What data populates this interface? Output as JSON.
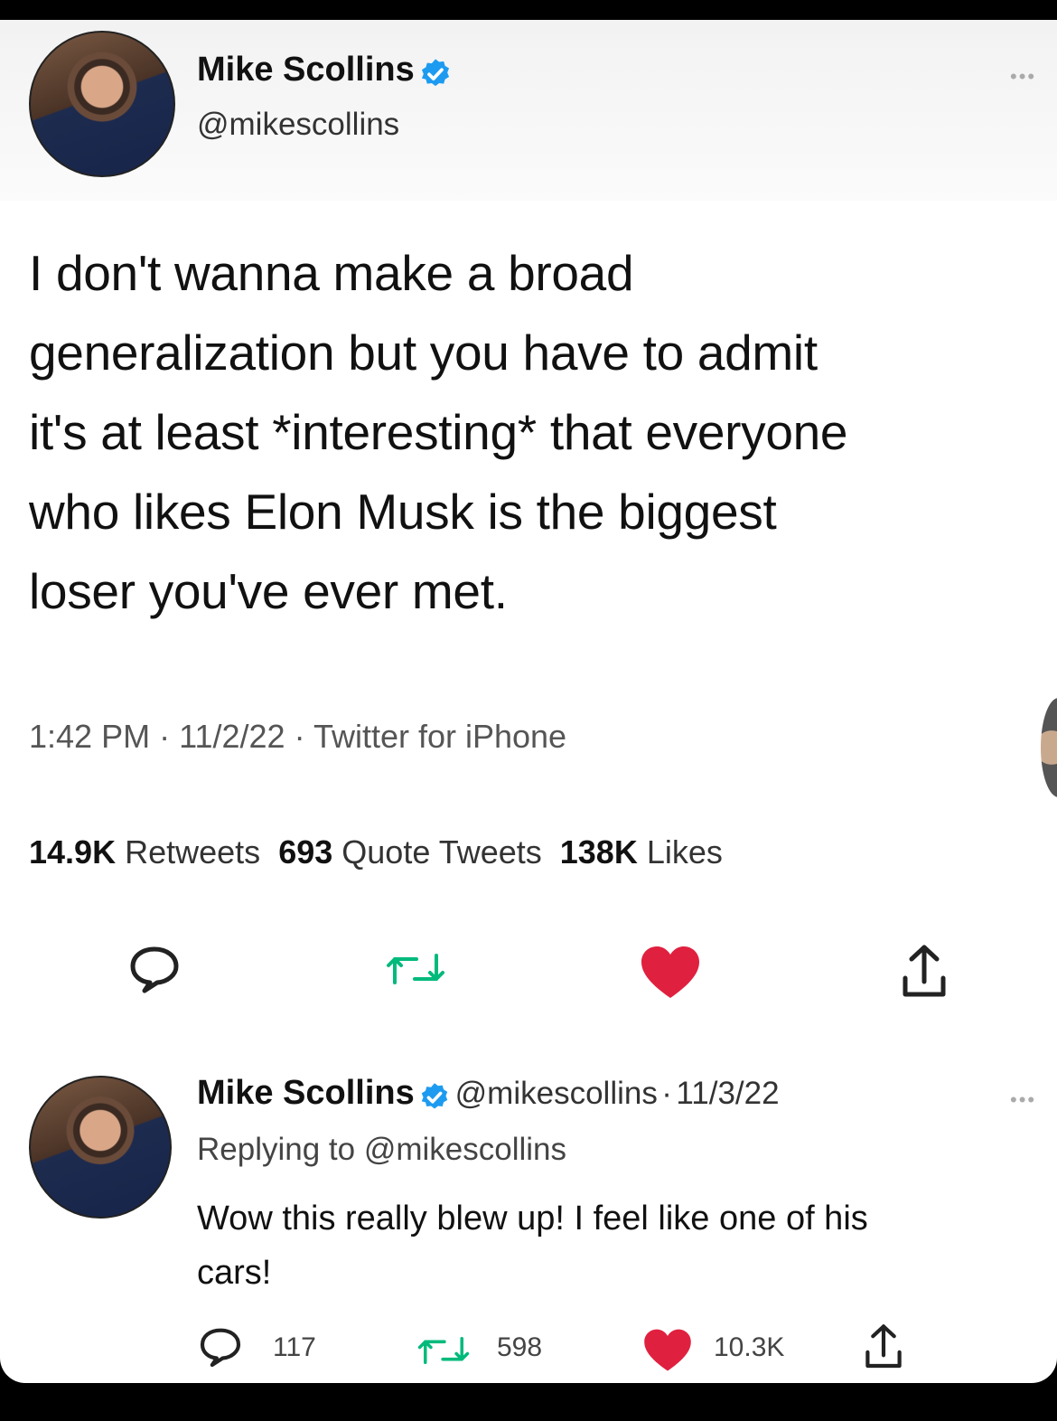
{
  "tweet": {
    "author_name": "Mike Scollins",
    "author_handle": "@mikescollins",
    "text_lines": [
      "I don't wanna make a broad",
      "generalization but you have to admit",
      "it's at least *interesting* that everyone",
      "who likes Elon Musk is the biggest",
      "loser you've ever met."
    ],
    "time": "1:42 PM",
    "date": "11/2/22",
    "source": "Twitter for iPhone",
    "sep": "·",
    "retweets_count": "14.9K",
    "retweets_label": "Retweets",
    "quotes_count": "693",
    "quotes_label": "Quote Tweets",
    "likes_count": "138K",
    "likes_label": "Likes"
  },
  "reply": {
    "author_name": "Mike Scollins",
    "author_handle": "@mikescollins",
    "date": "11/3/22",
    "sep": "·",
    "replying_to": "Replying to @mikescollins",
    "text_lines": [
      "Wow this really blew up! I feel like one of his",
      "cars!"
    ],
    "reply_count": "117",
    "retweet_count": "598",
    "like_count": "10.3K"
  },
  "colors": {
    "verified": "#1d9bf0",
    "retweet": "#00ba7c",
    "like": "#f91880"
  }
}
